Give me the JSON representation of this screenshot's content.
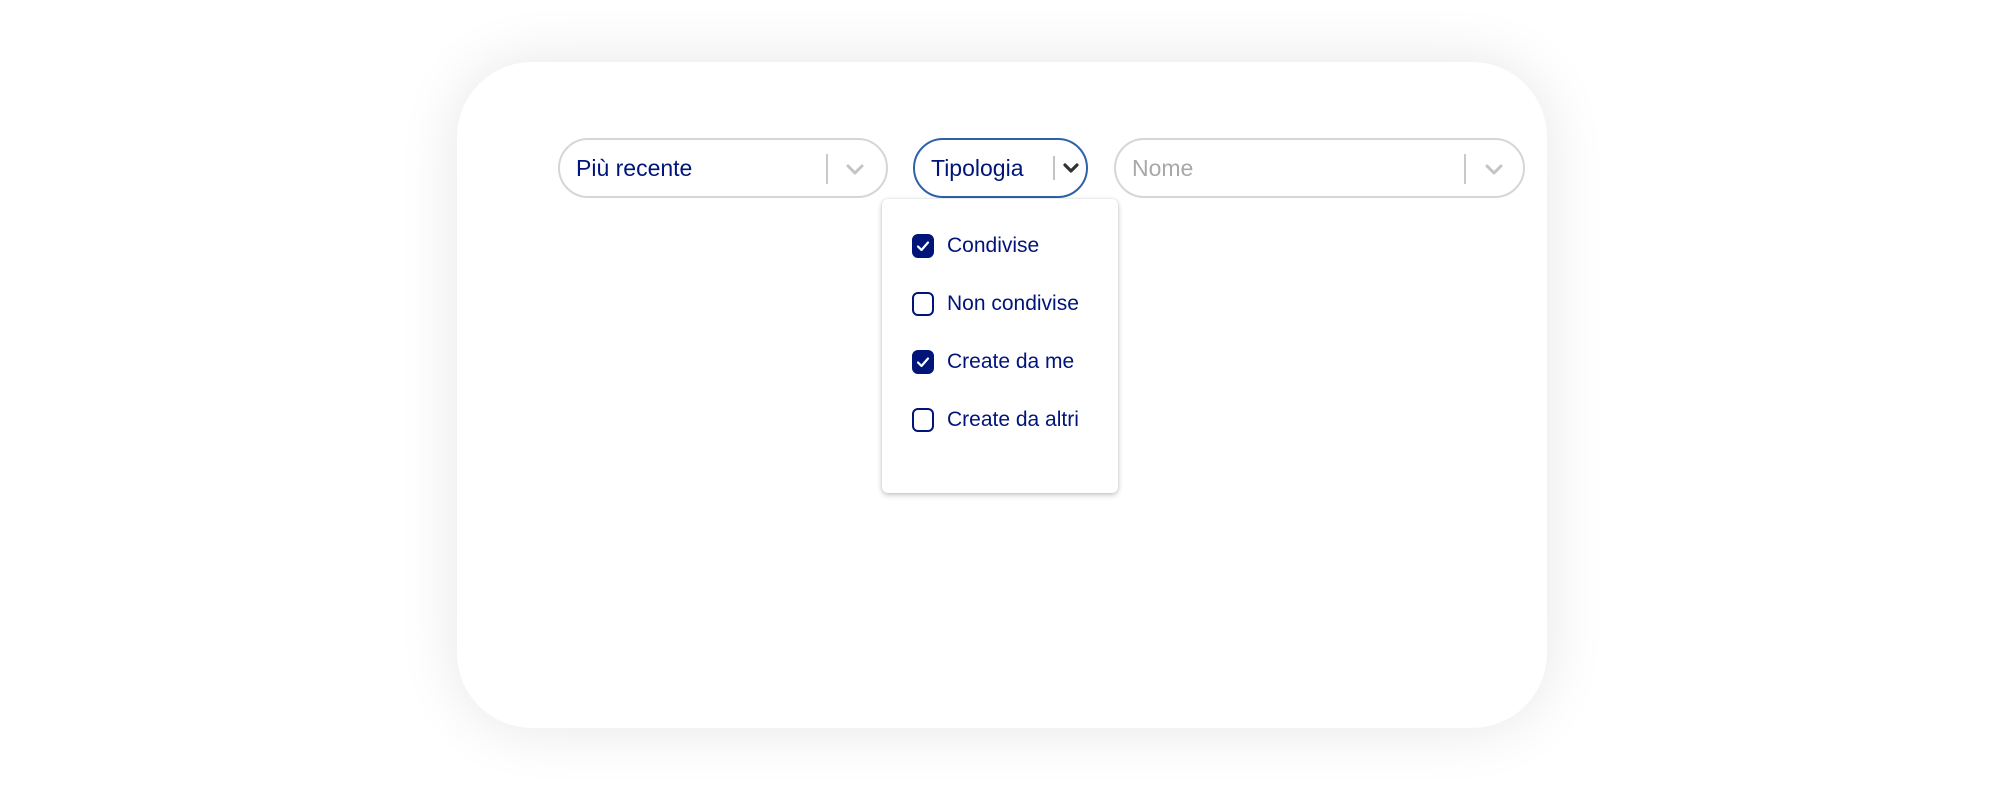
{
  "colors": {
    "primary": "#00147a",
    "focus_border": "#2f61a8",
    "border": "#d6d6d6",
    "placeholder": "#a8a8a8"
  },
  "filters": {
    "sort": {
      "value": "Più recente",
      "icon": "chevron-down-icon"
    },
    "type": {
      "value": "Tipologia",
      "icon": "chevron-down-icon",
      "open": true
    },
    "name": {
      "placeholder": "Nome",
      "icon": "chevron-down-icon"
    }
  },
  "type_menu": {
    "options": [
      {
        "label": "Condivise",
        "checked": true
      },
      {
        "label": "Non condivise",
        "checked": false
      },
      {
        "label": "Create da me",
        "checked": true
      },
      {
        "label": "Create da altri",
        "checked": false
      }
    ]
  }
}
